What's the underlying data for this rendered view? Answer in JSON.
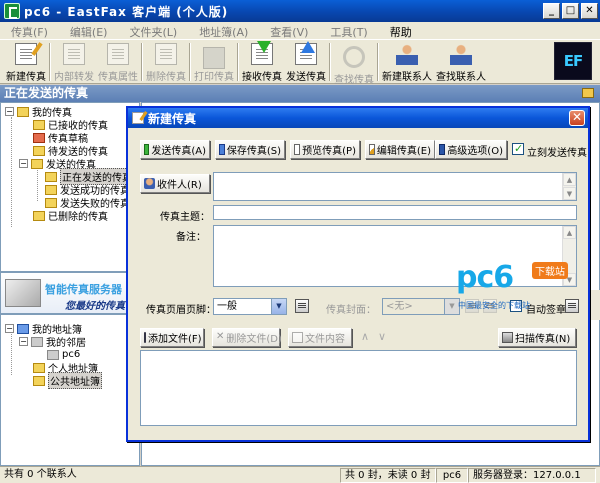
{
  "app": {
    "title": "pc6 - EastFax 客户端 (个人版)",
    "logo_text": "EF"
  },
  "menu": [
    {
      "label": "传真(F)"
    },
    {
      "label": "编辑(E)"
    },
    {
      "label": "文件夹(L)"
    },
    {
      "label": "地址簿(A)"
    },
    {
      "label": "查看(V)"
    },
    {
      "label": "工具(T)"
    },
    {
      "label": "帮助"
    }
  ],
  "toolbar": {
    "new_fax": "新建传真",
    "forward": "内部转发",
    "properties": "传真属性",
    "delete": "删除传真",
    "print": "打印传真",
    "receive": "接收传真",
    "send": "发送传真",
    "find": "查找传真",
    "new_contact": "新建联系人",
    "find_contact": "查找联系人"
  },
  "section_header": "正在发送的传真",
  "folder_tree": {
    "root": "我的传真",
    "items": [
      {
        "label": "已接收的传真"
      },
      {
        "label": "传真草稿"
      },
      {
        "label": "待发送的传真"
      },
      {
        "label": "发送的传真"
      },
      {
        "label": "正在发送的传真"
      },
      {
        "label": "发送成功的传真"
      },
      {
        "label": "发送失败的传真"
      },
      {
        "label": "已删除的传真"
      }
    ]
  },
  "banner": {
    "line1": "智能传真服务器",
    "line2": "您最好的传真"
  },
  "address_tree": {
    "root": "我的地址簿",
    "neighbors": "我的邻居",
    "pc": "pc6",
    "personal": "个人地址簿",
    "public": "公共地址簿"
  },
  "status": {
    "contacts": "共有 0 个联系人",
    "counts": "共 0 封，未读 0 封",
    "user": "pc6",
    "server": "服务器登录：127.0.0.1"
  },
  "dialog": {
    "title": "新建传真",
    "send_btn": "发送传真(A)",
    "save_btn": "保存传真(S)",
    "preview_btn": "预览传真(P)",
    "edit_btn": "编辑传真(E)",
    "advanced_btn": "高级选项(O)",
    "send_now_label": "立刻发送传真",
    "send_now_checked": true,
    "recipient_btn": "收件人(R)",
    "recipient_value": "",
    "subject_label": "传真主题：",
    "subject_value": "",
    "remark_label": "备注：",
    "remark_value": "",
    "header_footer_label": "传真页眉页脚：",
    "header_footer_value": "一般",
    "cover_label": "传真封面：",
    "cover_value": "<无>",
    "auto_sign_label": "自动签章",
    "add_file_btn": "添加文件(F)",
    "remove_file_btn": "删除文件(D)",
    "file_content_btn": "文件内容",
    "scan_btn": "扫描传真(N)"
  },
  "watermark": {
    "brand": "pc6",
    "badge": "下载站",
    "slogan": "中国最安全的下载站"
  }
}
